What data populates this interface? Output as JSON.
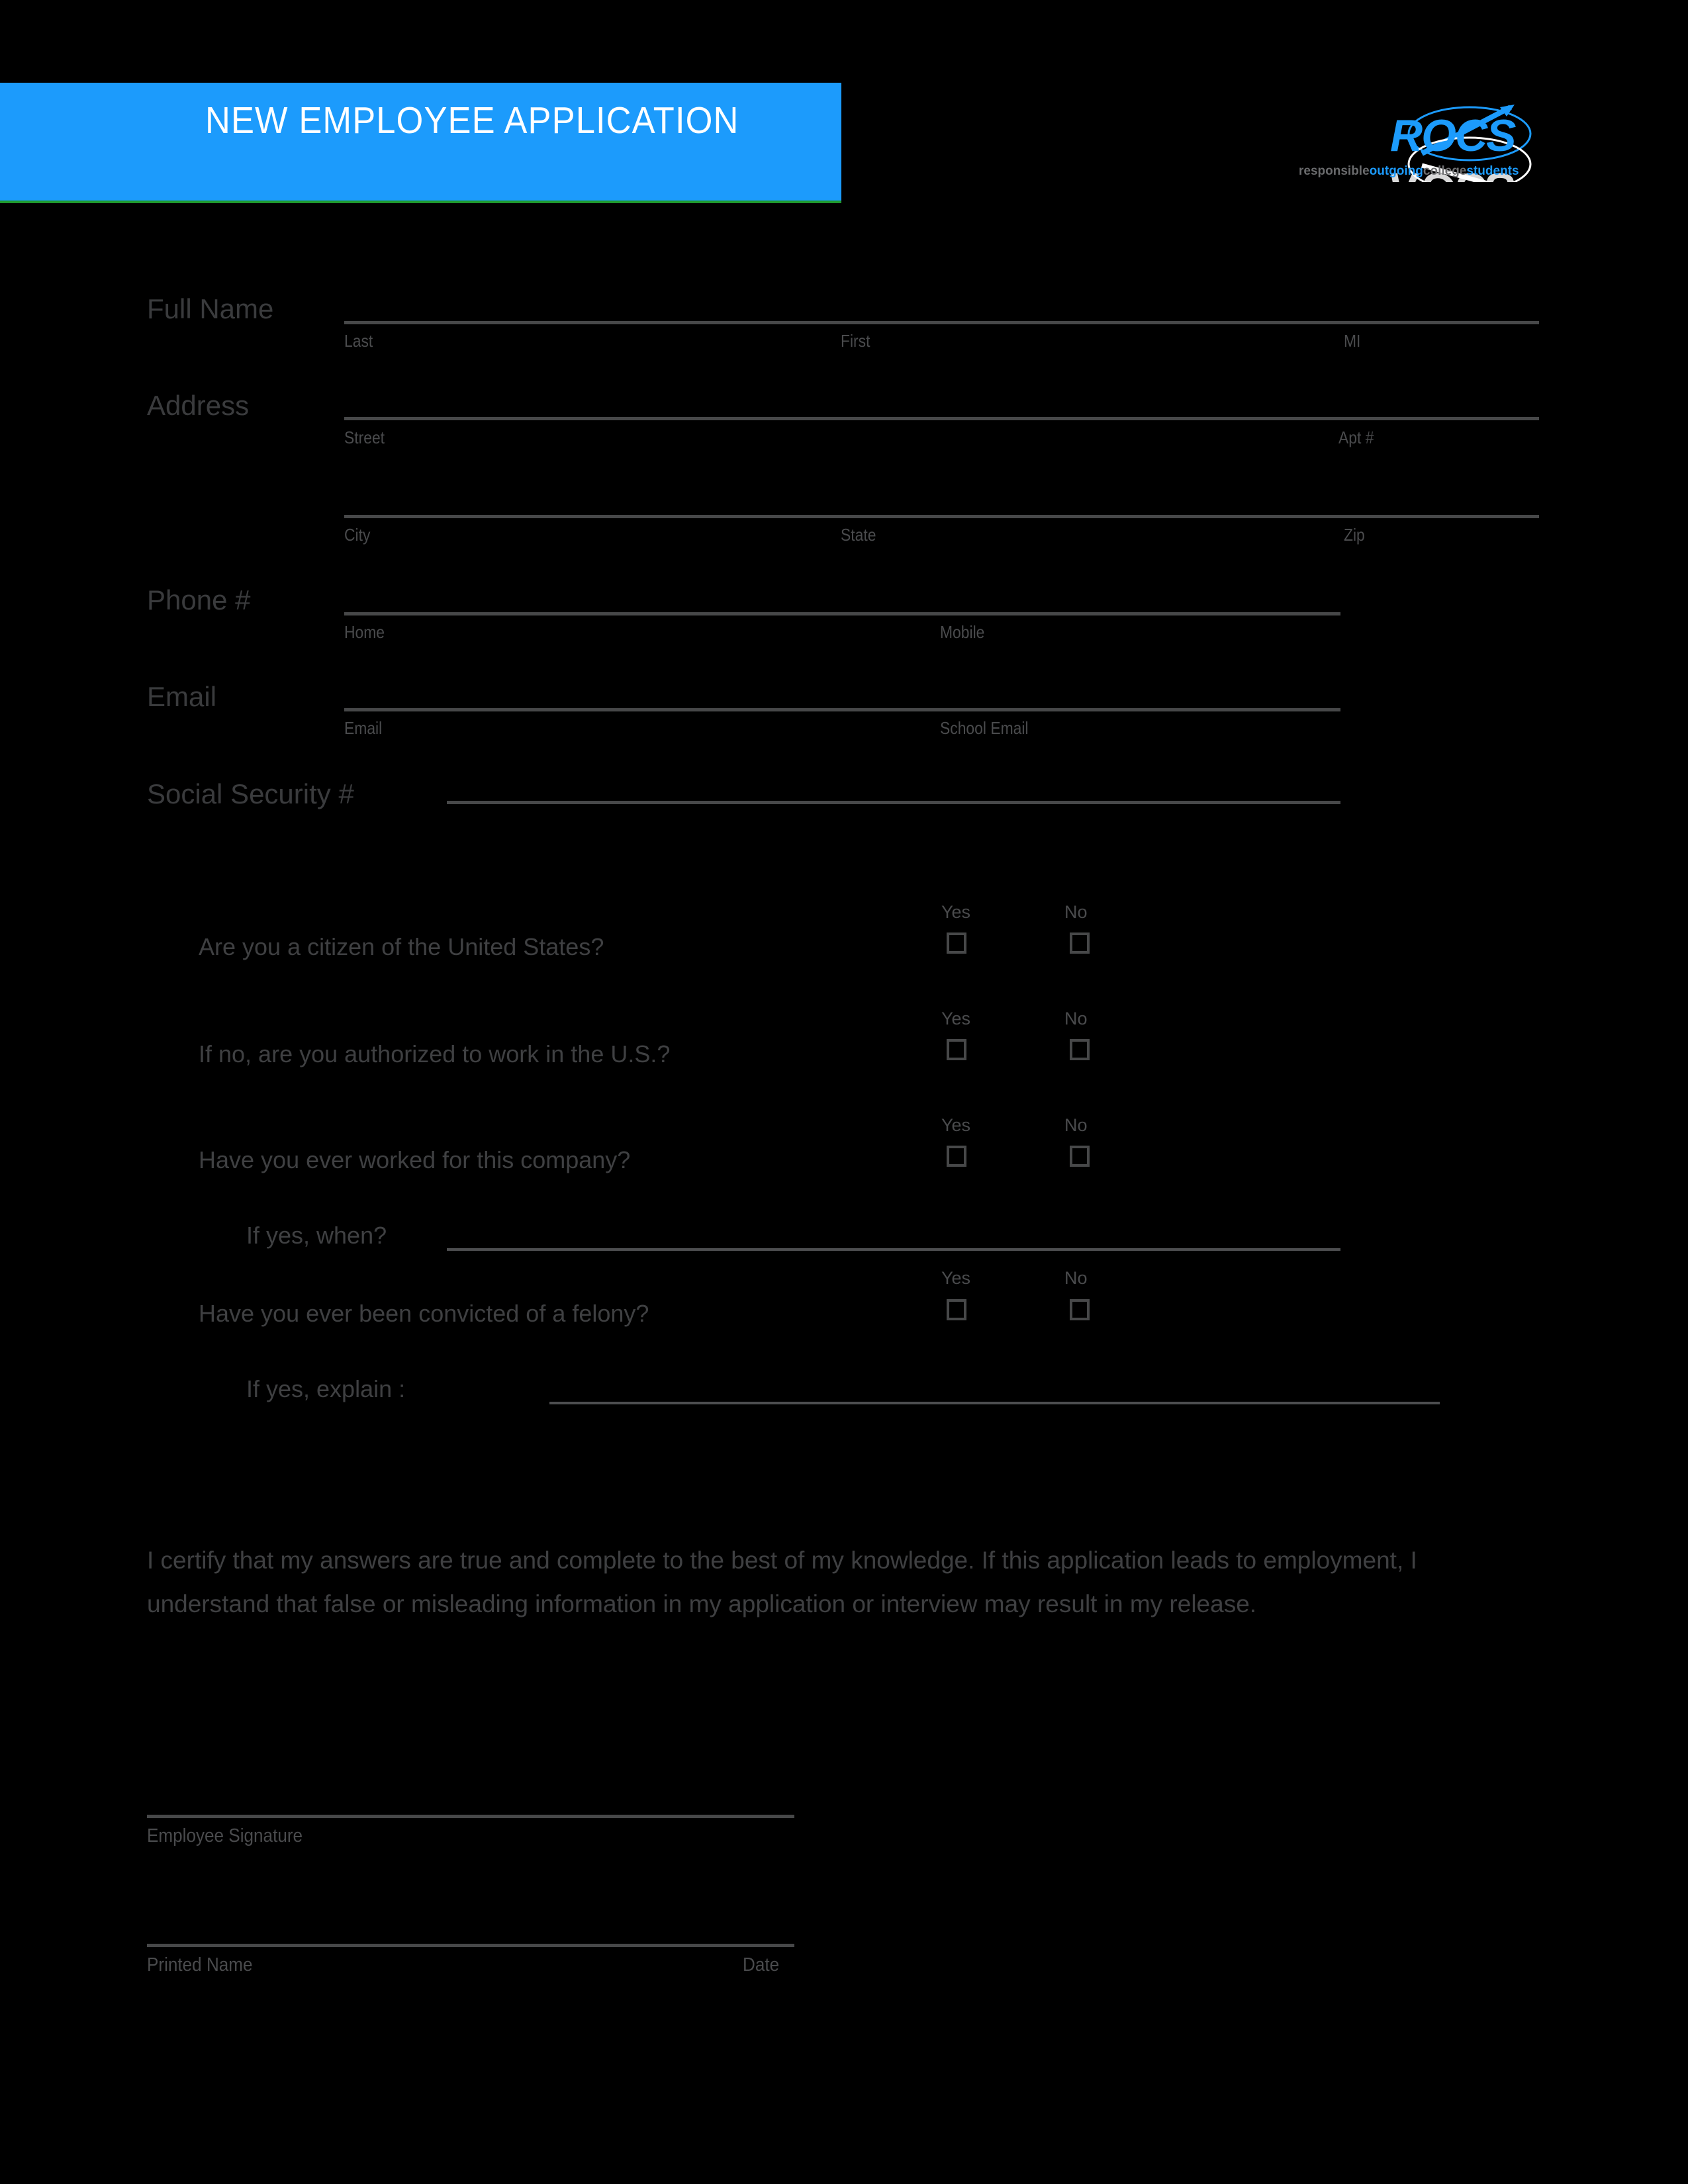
{
  "header": {
    "title": "NEW EMPLOYEE APPLICATION",
    "bar_color": "#1c9bfc",
    "title_color": "#ffffff",
    "accent_rule_color": "#1f9a2e"
  },
  "logo": {
    "wordmark": "ROCS",
    "tagline_parts": [
      "responsible",
      "outgoing",
      "college",
      "students"
    ],
    "tagline": "responsible outgoing college students",
    "primary_color": "#1c9bfc",
    "secondary_color": "#ffffff"
  },
  "form": {
    "full_name": {
      "label": "Full Name",
      "sub_labels": [
        "Last",
        "First",
        "MI"
      ]
    },
    "address": {
      "label": "Address",
      "sub_labels_row1": [
        "Street",
        "Apt #"
      ],
      "sub_labels_row2": [
        "City",
        "State",
        "Zip"
      ]
    },
    "phone": {
      "label": "Phone #",
      "sub_labels": [
        "Home",
        "Mobile"
      ]
    },
    "email": {
      "label": "Email",
      "sub_labels": [
        "Email",
        "School Email"
      ]
    },
    "ssn": {
      "label": "Social Security #"
    }
  },
  "questions": {
    "yes_label": "Yes",
    "no_label": "No",
    "items": [
      {
        "text": "Are you a citizen of the United States?"
      },
      {
        "text": "If no, are you authorized to work in the U.S.?"
      },
      {
        "text": "Have you ever worked for this company?"
      },
      {
        "text": "Have you ever been convicted of a felony?"
      }
    ],
    "followups": [
      {
        "text": "If yes, when?"
      },
      {
        "text": "If yes, explain :"
      }
    ]
  },
  "certification": {
    "text": "I certify that my answers are true and complete to the best of my knowledge.  If this application leads to employment, I understand that false or misleading information in my application or interview may result in my release."
  },
  "signature": {
    "employee_signature_label": "Employee Signature",
    "printed_name_label": "Printed Name",
    "date_label": "Date"
  }
}
